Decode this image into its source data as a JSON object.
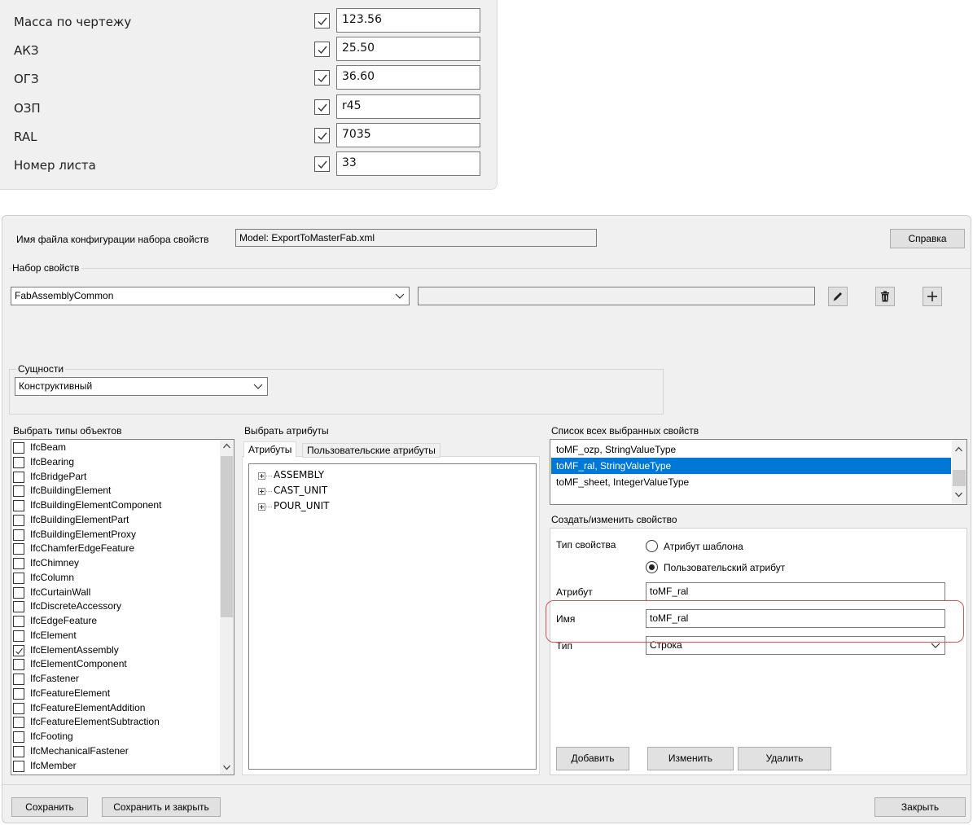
{
  "props": [
    {
      "label": "Масса по чертежу",
      "checked": true,
      "value": "123.56"
    },
    {
      "label": "АКЗ",
      "checked": true,
      "value": "25.50"
    },
    {
      "label": "ОГЗ",
      "checked": true,
      "value": "36.60"
    },
    {
      "label": "ОЗП",
      "checked": true,
      "value": "r45"
    },
    {
      "label": "RAL",
      "checked": true,
      "value": "7035"
    },
    {
      "label": "Номер листа",
      "checked": true,
      "value": "33"
    }
  ],
  "dialog": {
    "config_label": "Имя файла конфигурации набора свойств",
    "config_value": "Model: ExportToMasterFab.xml",
    "help_button": "Справка",
    "propset_group": "Набор свойств",
    "propset_value": "FabAssemblyCommon",
    "propset_desc": "",
    "entities_group": "Сущности",
    "entities_value": "Конструктивный",
    "types_title": "Выбрать типы объектов",
    "attrs_title": "Выбрать атрибуты",
    "tabs": [
      "Атрибуты",
      "Пользовательские атрибуты"
    ],
    "tree": [
      "ASSEMBLY",
      "CAST_UNIT",
      "POUR_UNIT"
    ],
    "selected_title": "Список всех выбранных свойств",
    "selected_props": [
      {
        "text": "toMF_ozp,  StringValueType",
        "selected": false
      },
      {
        "text": "toMF_ral,  StringValueType",
        "selected": true
      },
      {
        "text": "toMF_sheet,  IntegerValueType",
        "selected": false
      }
    ],
    "edit_group": "Создать/изменить свойство",
    "prop_type_label": "Тип свойства",
    "radio_template": "Атрибут шаблона",
    "radio_user": "Пользовательский атрибут",
    "radio_selected": "user",
    "attribute_label": "Атрибут",
    "attribute_value": "toMF_ral",
    "name_label": "Имя",
    "name_value": "toMF_ral",
    "type_label": "Тип",
    "type_value": "Строка",
    "add_button": "Добавить",
    "modify_button": "Изменить",
    "delete_button": "Удалить",
    "save_button": "Сохранить",
    "save_close_button": "Сохранить и закрыть",
    "close_button": "Закрыть",
    "highlight_color": "#d9534f",
    "selection_color": "#0078d7"
  },
  "types": [
    {
      "name": "IfcBeam",
      "checked": false
    },
    {
      "name": "IfcBearing",
      "checked": false
    },
    {
      "name": "IfcBridgePart",
      "checked": false
    },
    {
      "name": "IfcBuildingElement",
      "checked": false
    },
    {
      "name": "IfcBuildingElementComponent",
      "checked": false
    },
    {
      "name": "IfcBuildingElementPart",
      "checked": false
    },
    {
      "name": "IfcBuildingElementProxy",
      "checked": false
    },
    {
      "name": "IfcChamferEdgeFeature",
      "checked": false
    },
    {
      "name": "IfcChimney",
      "checked": false
    },
    {
      "name": "IfcColumn",
      "checked": false
    },
    {
      "name": "IfcCurtainWall",
      "checked": false
    },
    {
      "name": "IfcDiscreteAccessory",
      "checked": false
    },
    {
      "name": "IfcEdgeFeature",
      "checked": false
    },
    {
      "name": "IfcElement",
      "checked": false
    },
    {
      "name": "IfcElementAssembly",
      "checked": true
    },
    {
      "name": "IfcElementComponent",
      "checked": false
    },
    {
      "name": "IfcFastener",
      "checked": false
    },
    {
      "name": "IfcFeatureElement",
      "checked": false
    },
    {
      "name": "IfcFeatureElementAddition",
      "checked": false
    },
    {
      "name": "IfcFeatureElementSubtraction",
      "checked": false
    },
    {
      "name": "IfcFooting",
      "checked": false
    },
    {
      "name": "IfcMechanicalFastener",
      "checked": false
    },
    {
      "name": "IfcMember",
      "checked": false
    }
  ]
}
